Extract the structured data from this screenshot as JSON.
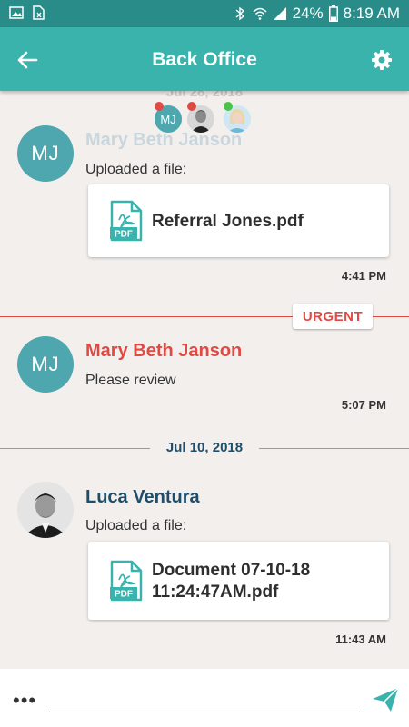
{
  "status_bar": {
    "battery": "24%",
    "time": "8:19 AM"
  },
  "header": {
    "title": "Back Office"
  },
  "participants": {
    "first_initials": "MJ"
  },
  "faded_date": "Jul 28, 2018",
  "messages": [
    {
      "sender": "Mary Beth Janson",
      "initials": "MJ",
      "text": "Uploaded a file:",
      "file": "Referral Jones.pdf",
      "time": "4:41 PM"
    },
    {
      "sender": "Mary Beth Janson",
      "initials": "MJ",
      "text": "Please review",
      "time": "5:07 PM",
      "badge": "URGENT"
    },
    {
      "sender": "Luca Ventura",
      "text": "Uploaded a file:",
      "file_line1": "Document 07-10-18",
      "file_line2": "11:24:47AM.pdf",
      "time": "11:43 AM"
    }
  ],
  "date_separator": "Jul 10, 2018",
  "pdf_icon_label": "PDF",
  "composer": {
    "more_label": "•••",
    "placeholder": ""
  },
  "colors": {
    "accent": "#3bb3ad",
    "urgent": "#e04a44",
    "name_blue": "#1f4e6b",
    "avatar": "#4ea7ae"
  }
}
